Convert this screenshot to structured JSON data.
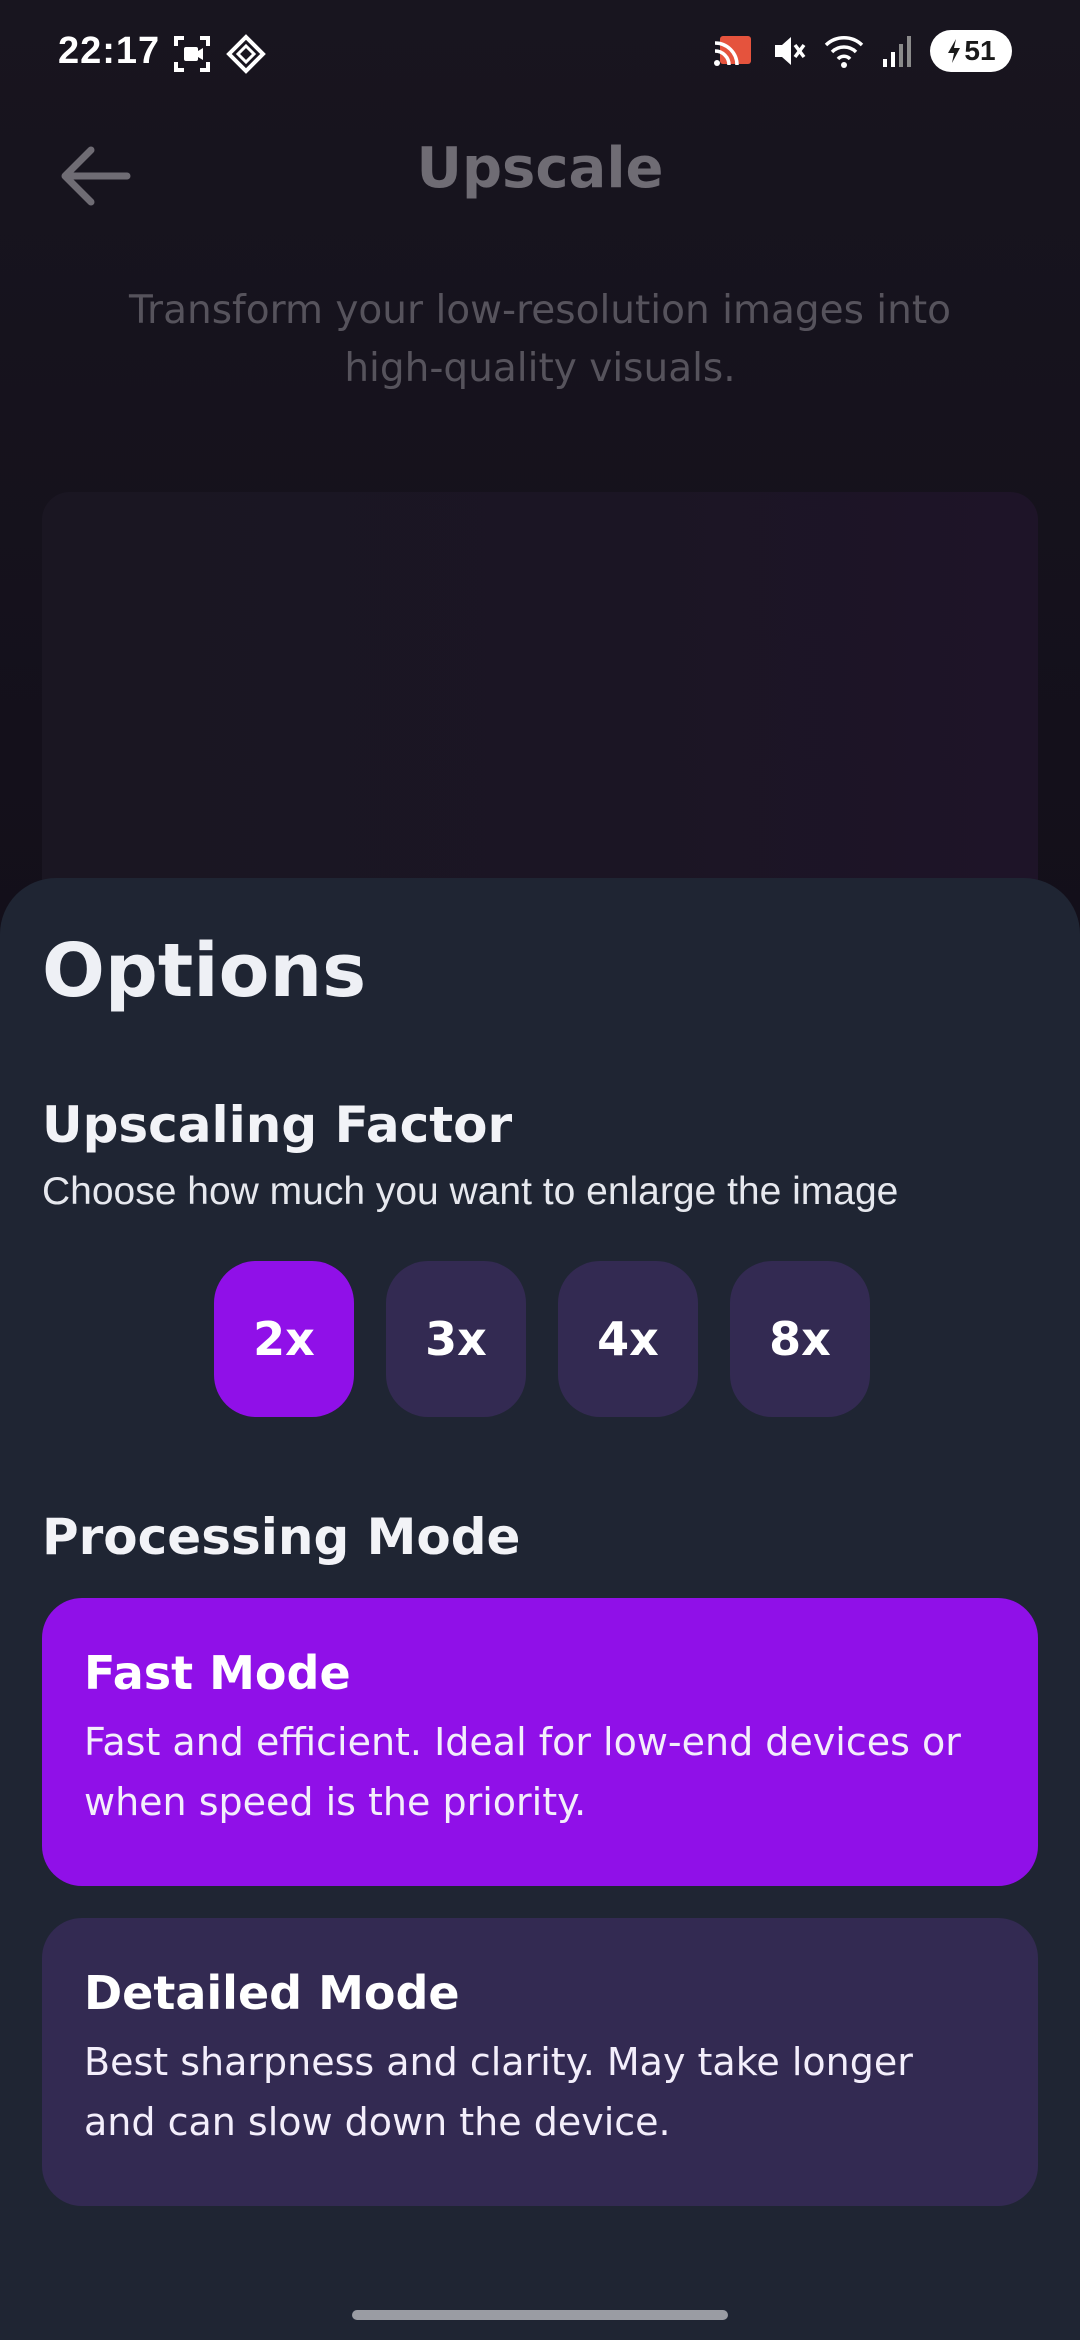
{
  "status_bar": {
    "time": "22:17",
    "battery": "51",
    "left_icons": [
      "screen-record-icon",
      "assistant-icon"
    ],
    "right_icons": [
      "cast-icon",
      "mute-icon",
      "wifi-icon",
      "signal-icon"
    ]
  },
  "header": {
    "back_icon": "arrow-left-icon",
    "title": "Upscale",
    "subtitle": "Transform your low-resolution images into high-quality visuals."
  },
  "sheet": {
    "title": "Options",
    "upscaling": {
      "heading": "Upscaling Factor",
      "description": "Choose how much you want to enlarge the image",
      "options": [
        "2x",
        "3x",
        "4x",
        "8x"
      ],
      "selected": "2x"
    },
    "processing": {
      "heading": "Processing Mode",
      "modes": [
        {
          "title": "Fast Mode",
          "description": "Fast and efficient. Ideal for low-end devices or when speed is the priority.",
          "selected": true
        },
        {
          "title": "Detailed Mode",
          "description": "Best sharpness and clarity. May take longer and can slow down the device.",
          "selected": false
        }
      ]
    }
  },
  "colors": {
    "accent": "#9010e8",
    "chip_bg": "#332a52",
    "sheet_bg": "#1f2533"
  }
}
